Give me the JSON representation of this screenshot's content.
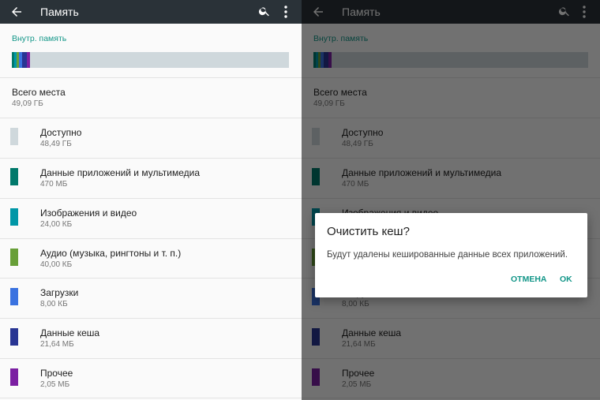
{
  "header": {
    "title": "Память"
  },
  "storage": {
    "section_title": "Внутр. память",
    "total_label": "Всего места",
    "total_value": "49,09 ГБ",
    "categories": [
      {
        "label": "Доступно",
        "value": "48,49 ГБ",
        "color": "#cfd8dc"
      },
      {
        "label": "Данные приложений и мультимедиа",
        "value": "470 МБ",
        "color": "#00796b"
      },
      {
        "label": "Изображения и видео",
        "value": "24,00 КБ",
        "color": "#0097a7"
      },
      {
        "label": "Аудио (музыка, рингтоны и т. п.)",
        "value": "40,00 КБ",
        "color": "#689f38"
      },
      {
        "label": "Загрузки",
        "value": "8,00 КБ",
        "color": "#3a72e0"
      },
      {
        "label": "Данные кеша",
        "value": "21,64 МБ",
        "color": "#283593"
      },
      {
        "label": "Прочее",
        "value": "2,05 МБ",
        "color": "#7b1fa2"
      }
    ]
  },
  "dialog": {
    "title": "Очистить кеш?",
    "message": "Будут удалены кешированные данные всех приложений.",
    "cancel_label": "ОТМЕНА",
    "ok_label": "OK"
  },
  "colors": {
    "accent": "#129688",
    "toolbar": "#2a3238"
  }
}
